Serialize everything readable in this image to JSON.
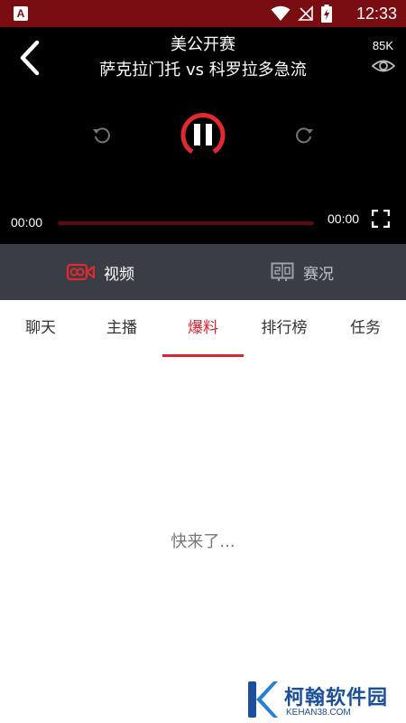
{
  "status_bar": {
    "app_icon_letter": "A",
    "time": "12:33",
    "icons": [
      "wifi-icon",
      "no-signal-icon",
      "battery-charging-icon"
    ]
  },
  "player": {
    "title": "美公开赛",
    "subtitle": "萨克拉门托 vs 科罗拉多急流",
    "viewer_count": "85K",
    "current_time": "00:00",
    "total_time": "00:00",
    "progress": 0,
    "state": "paused",
    "accent_color": "#e02a2f"
  },
  "mode_tabs": [
    {
      "label": "视频",
      "icon": "video-camera-icon",
      "active": true
    },
    {
      "label": "赛况",
      "icon": "scoreboard-icon",
      "active": false
    }
  ],
  "sub_tabs": [
    {
      "label": "聊天",
      "active": false
    },
    {
      "label": "主播",
      "active": false
    },
    {
      "label": "爆料",
      "active": true
    },
    {
      "label": "排行榜",
      "active": false
    },
    {
      "label": "任务",
      "active": false
    }
  ],
  "content": {
    "empty_message": "快来了..."
  },
  "watermark": {
    "name": "柯翰软件园",
    "url": "KEHAN38.COM"
  },
  "colors": {
    "status_bar": "#7a0d12",
    "active_tab": "#d32731",
    "mode_bar": "#3a3d45"
  }
}
